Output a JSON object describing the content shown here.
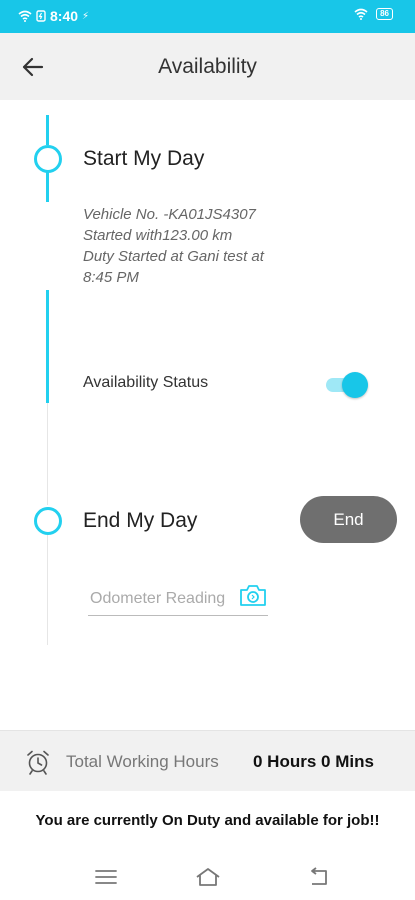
{
  "status_bar": {
    "time": "8:40",
    "battery": "86",
    "icons": [
      "wifi-icon",
      "charging-icon",
      "signal-icon"
    ]
  },
  "header": {
    "title": "Availability",
    "back_icon": "arrow-left-icon"
  },
  "start_day": {
    "title": "Start My Day",
    "vehicle": "Vehicle No. -KA01JS4307",
    "started_with": "Started with123.00 km",
    "duty_started": "Duty Started at Gani test at 8:45 PM"
  },
  "availability": {
    "label": "Availability Status",
    "enabled": true
  },
  "end_day": {
    "title": "End My Day",
    "end_button": "End",
    "odometer_placeholder": "Odometer Reading",
    "odometer_value": ""
  },
  "working_hours": {
    "label": "Total Working Hours",
    "value": "0 Hours 0 Mins"
  },
  "duty_message": "You are currently On Duty and available for job!!",
  "colors": {
    "accent": "#18c6e8",
    "end_button": "#6f6f6f",
    "bar_bg": "#f1f1f1"
  }
}
